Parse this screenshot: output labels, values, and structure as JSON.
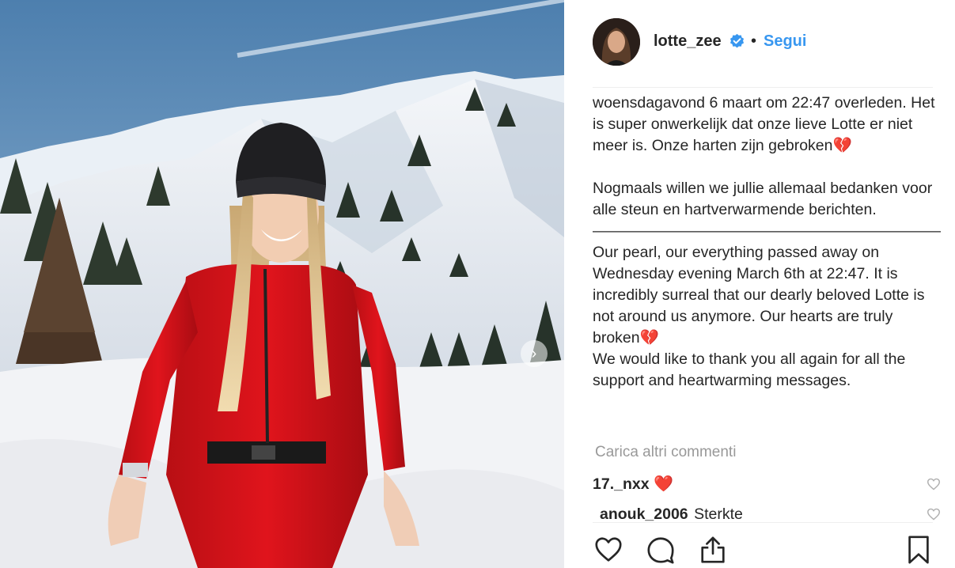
{
  "post": {
    "username": "lotte_zee",
    "verified": true,
    "separator": "•",
    "follow_label": "Segui"
  },
  "caption": {
    "text": "woensdagavond 6 maart om 22:47 overleden. Het is super onwerkelijk dat onze lieve Lotte er niet meer is. Onze harten zijn gebroken💔\n\nNogmaals willen we jullie allemaal bedanken voor alle steun en hartverwarmende berichten.\n——————————————————————————- Our pearl, our everything passed away on Wednesday evening March 6th at 22:47. It is incredibly surreal that our dearly beloved Lotte is not around us anymore. Our hearts are truly broken💔\nWe would like to thank you all again for all the support and heartwarming messages."
  },
  "load_more_label": "Carica altri commenti",
  "comments": [
    {
      "user": "17._nxx",
      "text": "",
      "emoji": "❤️"
    },
    {
      "user": "anouk_2006",
      "text": "Sterkte",
      "emoji": ""
    }
  ],
  "icons": {
    "verified": "verified-badge-icon",
    "carousel_next": "chevron-right-icon",
    "like": "heart-outline-icon",
    "comment": "speech-bubble-icon",
    "share": "share-upload-icon",
    "save": "bookmark-icon"
  },
  "colors": {
    "link_blue": "#3897f0",
    "text_dark": "#262626",
    "muted_gray": "#999999",
    "heart_red": "#ed4956"
  }
}
